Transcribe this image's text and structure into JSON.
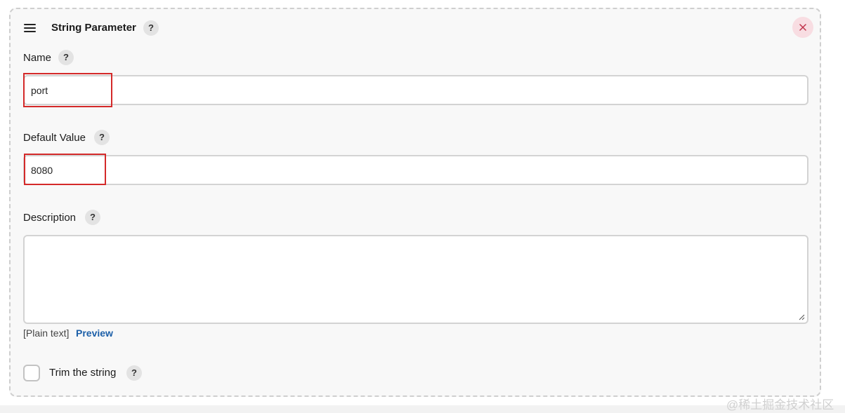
{
  "header": {
    "title": "String Parameter",
    "help": "?",
    "close_symbol": "×"
  },
  "fields": {
    "name": {
      "label": "Name",
      "help": "?",
      "value": "port"
    },
    "default_value": {
      "label": "Default Value",
      "help": "?",
      "value": "8080"
    },
    "description": {
      "label": "Description",
      "help": "?",
      "value": "",
      "format_note": "[Plain text]",
      "preview_label": "Preview"
    }
  },
  "trim": {
    "label": "Trim the string",
    "help": "?",
    "checked": false
  },
  "watermark": "@稀土掘金技术社区",
  "colors": {
    "highlight": "#d42a2a",
    "link": "#1c5fa8",
    "close_bg": "#f8dde2",
    "close_icon": "#c0324a"
  }
}
